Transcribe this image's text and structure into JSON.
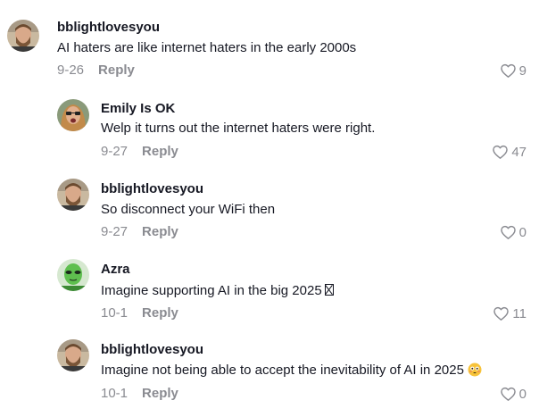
{
  "comments": [
    {
      "username": "bblightlovesyou",
      "text": "AI haters are like internet haters in the early 2000s",
      "date": "9-26",
      "reply_label": "Reply",
      "likes": "9",
      "avatar": "bearded-man-avatar"
    },
    {
      "username": "Emily Is OK",
      "text": "Welp it turns out the internet haters were right.",
      "date": "9-27",
      "reply_label": "Reply",
      "likes": "47",
      "avatar": "woman-sunglasses-avatar"
    },
    {
      "username": "bblightlovesyou",
      "text": "So disconnect your WiFi then",
      "date": "9-27",
      "reply_label": "Reply",
      "likes": "0",
      "avatar": "bearded-man-avatar"
    },
    {
      "username": "Azra",
      "text": "Imagine supporting AI in the big 2025",
      "text_suffix_icon": "missing-glyph-box",
      "date": "10-1",
      "reply_label": "Reply",
      "likes": "11",
      "avatar": "green-alien-avatar"
    },
    {
      "username": "bblightlovesyou",
      "text": "Imagine not being able to accept the inevitability of AI in 2025",
      "text_suffix_icon": "flushed-face-emoji",
      "date": "10-1",
      "reply_label": "Reply",
      "likes": "0",
      "avatar": "bearded-man-avatar"
    }
  ],
  "colors": {
    "text": "#161823",
    "secondary": "#8a8b91",
    "background": "#ffffff"
  }
}
